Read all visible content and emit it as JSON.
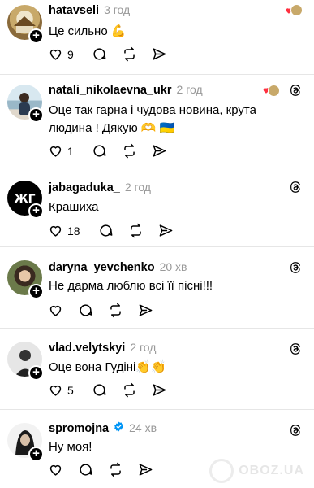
{
  "threads": [
    {
      "username": "hatavseli",
      "time": "3 год",
      "text": "Це сильно 💪",
      "likes": "9",
      "liked_by_author": true,
      "avatar_colors": [
        "#c8b48a",
        "#8a6a3a"
      ]
    },
    {
      "username": "natali_nikolaevna_ukr",
      "time": "2 год",
      "text": "Оце так гарна і чудова новина, крута людина ! Дякую 🫶 🇺🇦",
      "likes": "1",
      "liked_by_author": true,
      "avatar_colors": [
        "#cfe0ea",
        "#4a6a80"
      ]
    },
    {
      "username": "jabagaduka_",
      "time": "2 год",
      "text": "Крашиха",
      "likes": "18",
      "liked_by_author": false,
      "avatar_colors": [
        "#000000",
        "#ffffff"
      ]
    },
    {
      "username": "daryna_yevchenko",
      "time": "20 хв",
      "text": "Не дарма люблю всі її пісні!!!",
      "likes": "",
      "liked_by_author": false,
      "avatar_colors": [
        "#6b7a4a",
        "#3a2a20"
      ]
    },
    {
      "username": "vlad.velytskyi",
      "time": "2 год",
      "text": "Оце вона Гудіні👏👏",
      "likes": "5",
      "liked_by_author": false,
      "avatar_colors": [
        "#e8e8e8",
        "#222222"
      ]
    },
    {
      "username": "spromojna",
      "time": "24 хв",
      "text": "Ну моя!",
      "likes": "",
      "liked_by_author": false,
      "verified": true,
      "avatar_colors": [
        "#f2f2f2",
        "#1a1a1a"
      ]
    }
  ],
  "watermark": "OBOZ.UA",
  "colors": {
    "heart_red": "#ff3040",
    "verified_blue": "#0095f6",
    "muted": "#999999"
  }
}
